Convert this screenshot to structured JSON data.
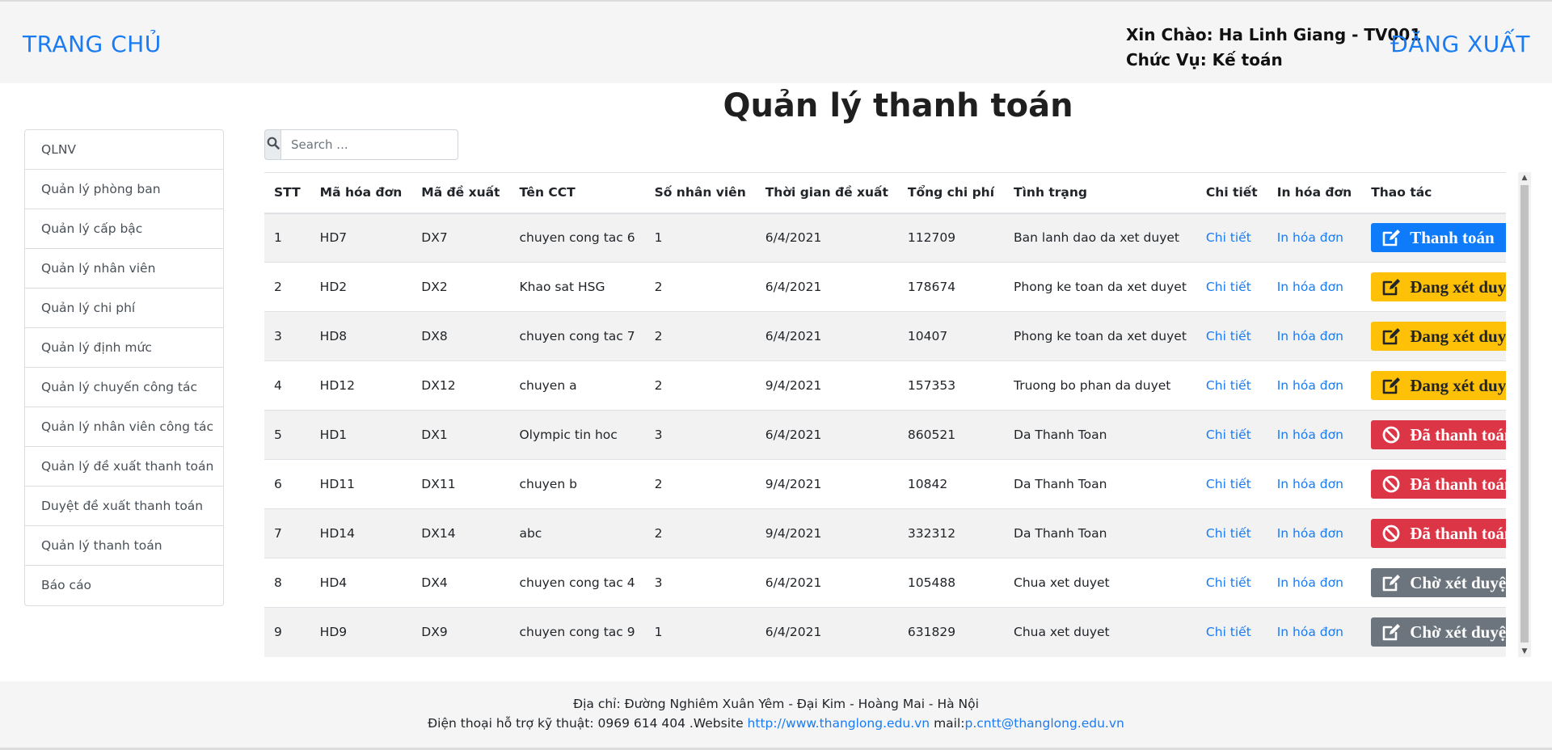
{
  "header": {
    "home_label": "TRANG CHỦ",
    "greeting_line1": "Xin Chào: Ha Linh Giang - TV001",
    "greeting_line2": "Chức Vụ: Kế toán",
    "logout_label": "ĐĂNG XUẤT"
  },
  "page_title": "Quản lý thanh toán",
  "sidebar": {
    "items": [
      {
        "label": "QLNV"
      },
      {
        "label": "Quản lý phòng ban"
      },
      {
        "label": "Quản lý cấp bậc"
      },
      {
        "label": "Quản lý nhân viên"
      },
      {
        "label": "Quản lý chi phí"
      },
      {
        "label": "Quản lý định mức"
      },
      {
        "label": "Quản lý chuyến công tác"
      },
      {
        "label": "Quản lý nhân viên công tác"
      },
      {
        "label": "Quản lý đề xuất thanh toán"
      },
      {
        "label": "Duyệt đề xuất thanh toán"
      },
      {
        "label": "Quản lý thanh toán"
      },
      {
        "label": "Báo cáo"
      }
    ]
  },
  "search": {
    "icon": "search-icon",
    "placeholder": "Search ...",
    "value": ""
  },
  "table": {
    "headers": [
      "STT",
      "Mã hóa đơn",
      "Mã đề xuất",
      "Tên CCT",
      "Số nhân viên",
      "Thời gian đề xuất",
      "Tổng chi phí",
      "Tình trạng",
      "Chi tiết",
      "In hóa đơn",
      "Thao tác"
    ],
    "rows": [
      {
        "stt": "1",
        "invoice": "HD7",
        "proposal": "DX7",
        "trip": "chuyen cong tac 6",
        "staff": "1",
        "date": "6/4/2021",
        "cost": "112709",
        "status": "Ban lanh dao da xet duyet",
        "detail": "Chi tiết",
        "print": "In hóa đơn",
        "action": "Thanh toán",
        "action_style": "primary",
        "action_icon": "edit-icon"
      },
      {
        "stt": "2",
        "invoice": "HD2",
        "proposal": "DX2",
        "trip": "Khao sat HSG",
        "staff": "2",
        "date": "6/4/2021",
        "cost": "178674",
        "status": "Phong ke toan da xet duyet",
        "detail": "Chi tiết",
        "print": "In hóa đơn",
        "action": "Đang xét duyệt",
        "action_style": "warning",
        "action_icon": "edit-icon"
      },
      {
        "stt": "3",
        "invoice": "HD8",
        "proposal": "DX8",
        "trip": "chuyen cong tac 7",
        "staff": "2",
        "date": "6/4/2021",
        "cost": "10407",
        "status": "Phong ke toan da xet duyet",
        "detail": "Chi tiết",
        "print": "In hóa đơn",
        "action": "Đang xét duyệt",
        "action_style": "warning",
        "action_icon": "edit-icon"
      },
      {
        "stt": "4",
        "invoice": "HD12",
        "proposal": "DX12",
        "trip": "chuyen a",
        "staff": "2",
        "date": "9/4/2021",
        "cost": "157353",
        "status": "Truong bo phan da duyet",
        "detail": "Chi tiết",
        "print": "In hóa đơn",
        "action": "Đang xét duyệt",
        "action_style": "warning",
        "action_icon": "edit-icon"
      },
      {
        "stt": "5",
        "invoice": "HD1",
        "proposal": "DX1",
        "trip": "Olympic tin hoc",
        "staff": "3",
        "date": "6/4/2021",
        "cost": "860521",
        "status": "Da Thanh Toan",
        "detail": "Chi tiết",
        "print": "In hóa đơn",
        "action": "Đã thanh toán",
        "action_style": "danger",
        "action_icon": "ban-icon"
      },
      {
        "stt": "6",
        "invoice": "HD11",
        "proposal": "DX11",
        "trip": "chuyen b",
        "staff": "2",
        "date": "9/4/2021",
        "cost": "10842",
        "status": "Da Thanh Toan",
        "detail": "Chi tiết",
        "print": "In hóa đơn",
        "action": "Đã thanh toán",
        "action_style": "danger",
        "action_icon": "ban-icon"
      },
      {
        "stt": "7",
        "invoice": "HD14",
        "proposal": "DX14",
        "trip": "abc",
        "staff": "2",
        "date": "9/4/2021",
        "cost": "332312",
        "status": "Da Thanh Toan",
        "detail": "Chi tiết",
        "print": "In hóa đơn",
        "action": "Đã thanh toán",
        "action_style": "danger",
        "action_icon": "ban-icon"
      },
      {
        "stt": "8",
        "invoice": "HD4",
        "proposal": "DX4",
        "trip": "chuyen cong tac 4",
        "staff": "3",
        "date": "6/4/2021",
        "cost": "105488",
        "status": "Chua xet duyet",
        "detail": "Chi tiết",
        "print": "In hóa đơn",
        "action": "Chờ xét duyệt",
        "action_style": "secondary",
        "action_icon": "edit-icon"
      },
      {
        "stt": "9",
        "invoice": "HD9",
        "proposal": "DX9",
        "trip": "chuyen cong tac 9",
        "staff": "1",
        "date": "6/4/2021",
        "cost": "631829",
        "status": "Chua xet duyet",
        "detail": "Chi tiết",
        "print": "In hóa đơn",
        "action": "Chờ xét duyệt",
        "action_style": "secondary",
        "action_icon": "edit-icon"
      }
    ]
  },
  "footer": {
    "address": "Địa chỉ: Đường Nghiêm Xuân Yêm - Đại Kim - Hoàng Mai - Hà Nội",
    "phone_prefix": "Điện thoại hỗ trợ kỹ thuật: 0969 614 404 .Website ",
    "website": "http://www.thanglong.edu.vn",
    "mail_prefix": " mail:",
    "email": "p.cntt@thanglong.edu.vn"
  },
  "colors": {
    "link": "#1a7bf2",
    "primary": "#0d7bfa",
    "warning": "#ffc107",
    "danger": "#dc3545",
    "secondary": "#6c757d"
  }
}
